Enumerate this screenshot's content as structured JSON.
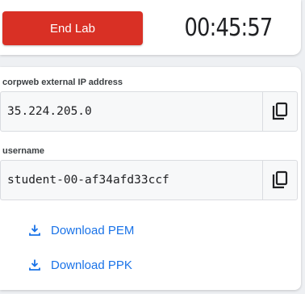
{
  "header": {
    "end_button_label": "End Lab",
    "timer": "00:45:57"
  },
  "fields": [
    {
      "label": "corpweb external IP address",
      "value": "35.224.205.0",
      "icon": "copy-icon"
    },
    {
      "label": "username",
      "value": "student-00-af34afd33ccf",
      "icon": "copy-icon"
    }
  ],
  "downloads": [
    {
      "label": "Download PEM",
      "icon": "download-icon"
    },
    {
      "label": "Download PPK",
      "icon": "download-icon"
    }
  ],
  "colors": {
    "end_button": "#d93025",
    "link": "#1a73e8",
    "background": "#eef0f3"
  }
}
